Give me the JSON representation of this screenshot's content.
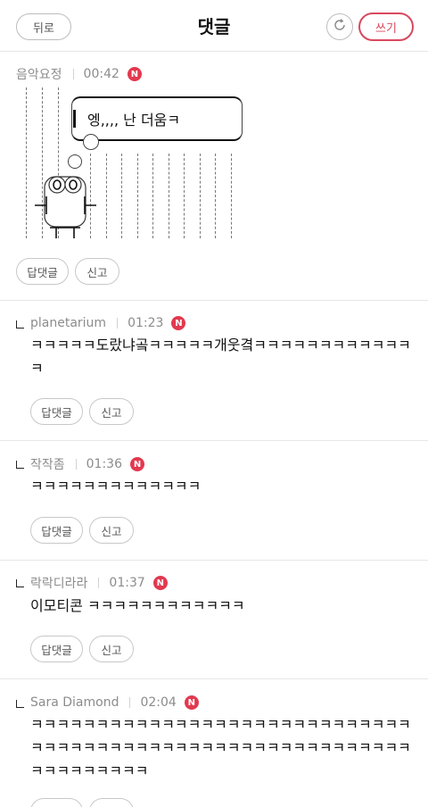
{
  "header": {
    "back_label": "뒤로",
    "title": "댓글",
    "write_label": "쓰기"
  },
  "colors": {
    "accent": "#d9485e",
    "badge": "#e2394f",
    "meta_text": "#8c8c8c"
  },
  "icons": {
    "refresh": "refresh-icon",
    "new_badge": "N"
  },
  "comments": [
    {
      "author": "음악요정",
      "time": "00:42",
      "badge": "N",
      "art_text": "엥,,,, 난 더움ㅋ",
      "actions": [
        "답댓글",
        "신고"
      ]
    },
    {
      "author": "planetarium",
      "time": "01:23",
      "badge": "N",
      "text": "ㅋㅋㅋㅋㅋ도랐냐곸ㅋㅋㅋㅋㅋ개웃곀ㅋㅋㅋㅋㅋㅋㅋㅋㅋㅋㅋㅋㅋ",
      "actions": [
        "답댓글",
        "신고"
      ]
    },
    {
      "author": "작작좀",
      "time": "01:36",
      "badge": "N",
      "text": "ㅋㅋㅋㅋㅋㅋㅋㅋㅋㅋㅋㅋㅋ",
      "actions": [
        "답댓글",
        "신고"
      ]
    },
    {
      "author": "락락디라라",
      "time": "01:37",
      "badge": "N",
      "text": "이모티콘 ㅋㅋㅋㅋㅋㅋㅋㅋㅋㅋㅋㅋ",
      "actions": [
        "답댓글",
        "신고"
      ]
    },
    {
      "author": "Sara Diamond",
      "time": "02:04",
      "badge": "N",
      "text": "ㅋㅋㅋㅋㅋㅋㅋㅋㅋㅋㅋㅋㅋㅋㅋㅋㅋㅋㅋㅋㅋㅋㅋㅋㅋㅋㅋㅋㅋㅋㅋㅋㅋㅋㅋㅋㅋㅋㅋㅋㅋㅋㅋㅋㅋㅋㅋㅋㅋㅋㅋㅋㅋㅋㅋㅋㅋㅋㅋㅋㅋㅋㅋㅋㅋㅋㅋ",
      "actions": [
        "답댓글",
        "신고"
      ]
    }
  ]
}
